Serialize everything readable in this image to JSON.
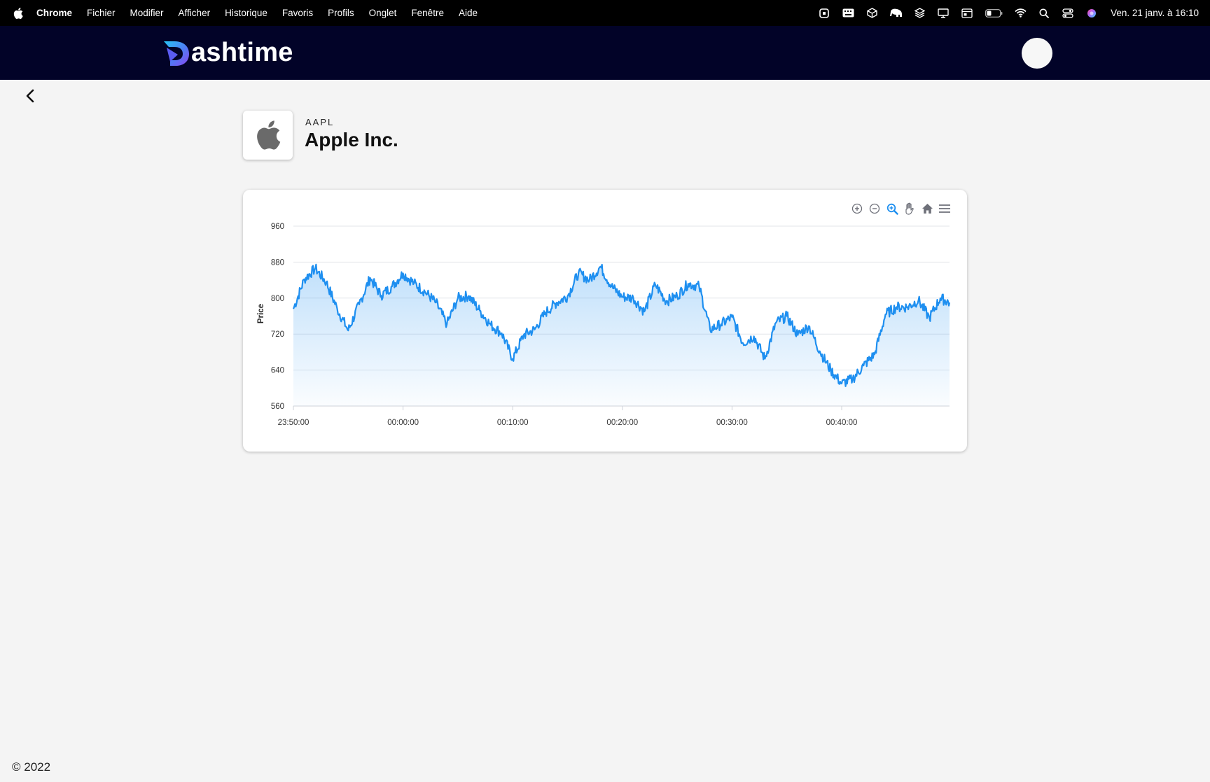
{
  "menubar": {
    "app_name": "Chrome",
    "items": [
      "Fichier",
      "Modifier",
      "Afficher",
      "Historique",
      "Favoris",
      "Profils",
      "Onglet",
      "Fenêtre",
      "Aide"
    ],
    "clock": "Ven. 21 janv. à  16:10",
    "status_icons": [
      "screen-record-icon",
      "keyboard-icon",
      "cube-icon",
      "elephant-icon",
      "layers-icon",
      "display-icon",
      "window-icon",
      "battery-icon",
      "wifi-icon",
      "spotlight-search-icon",
      "control-center-icon",
      "siri-icon"
    ]
  },
  "header": {
    "brand": "ashtime",
    "brand_color": "#5b6cf2",
    "background": "#020328"
  },
  "stock": {
    "ticker": "AAPL",
    "name": "Apple Inc."
  },
  "chart_toolbar": [
    "zoom-in-icon",
    "zoom-out-icon",
    "selection-zoom-icon",
    "pan-hand-icon",
    "reset-home-icon",
    "menu-icon"
  ],
  "chart_data": {
    "type": "area",
    "title": "",
    "xlabel": "",
    "ylabel": "Price",
    "ylim": [
      560,
      960
    ],
    "yticks": [
      560,
      640,
      720,
      800,
      880,
      960
    ],
    "xlim": [
      "23:50:00",
      "00:49:50"
    ],
    "xticks": [
      "23:50:00",
      "00:00:00",
      "00:10:00",
      "00:20:00",
      "00:30:00",
      "00:40:00"
    ],
    "grid": true,
    "line_color": "#1e8ff0",
    "series": [
      {
        "x": [
          "23:50:00",
          "23:51:00",
          "23:52:00",
          "23:53:00",
          "23:54:00",
          "23:55:00",
          "23:56:00",
          "23:57:00",
          "23:58:00",
          "23:59:00",
          "00:00:00",
          "00:01:00",
          "00:02:00",
          "00:03:00",
          "00:04:00",
          "00:05:00",
          "00:06:00",
          "00:07:00",
          "00:08:00",
          "00:09:00",
          "00:10:00",
          "00:11:00",
          "00:12:00",
          "00:13:00",
          "00:14:00",
          "00:15:00",
          "00:16:00",
          "00:17:00",
          "00:18:00",
          "00:19:00",
          "00:20:00",
          "00:21:00",
          "00:22:00",
          "00:23:00",
          "00:24:00",
          "00:25:00",
          "00:26:00",
          "00:27:00",
          "00:28:00",
          "00:29:00",
          "00:30:00",
          "00:31:00",
          "00:32:00",
          "00:33:00",
          "00:34:00",
          "00:35:00",
          "00:36:00",
          "00:37:00",
          "00:38:00",
          "00:39:00",
          "00:40:00",
          "00:41:00",
          "00:42:00",
          "00:43:00",
          "00:44:00",
          "00:45:00",
          "00:46:00",
          "00:47:00",
          "00:48:00",
          "00:49:00",
          "00:49:50"
        ],
        "values": [
          776,
          842,
          866,
          835,
          776,
          728,
          786,
          845,
          806,
          826,
          855,
          833,
          814,
          790,
          742,
          800,
          805,
          772,
          740,
          722,
          665,
          718,
          730,
          768,
          790,
          804,
          856,
          840,
          870,
          826,
          803,
          800,
          770,
          830,
          793,
          805,
          832,
          826,
          730,
          742,
          758,
          700,
          715,
          665,
          745,
          760,
          718,
          738,
          682,
          640,
          610,
          620,
          650,
          675,
          764,
          780,
          780,
          795,
          756,
          800,
          790
        ]
      }
    ]
  },
  "footer": {
    "copyright": "© 2022"
  }
}
